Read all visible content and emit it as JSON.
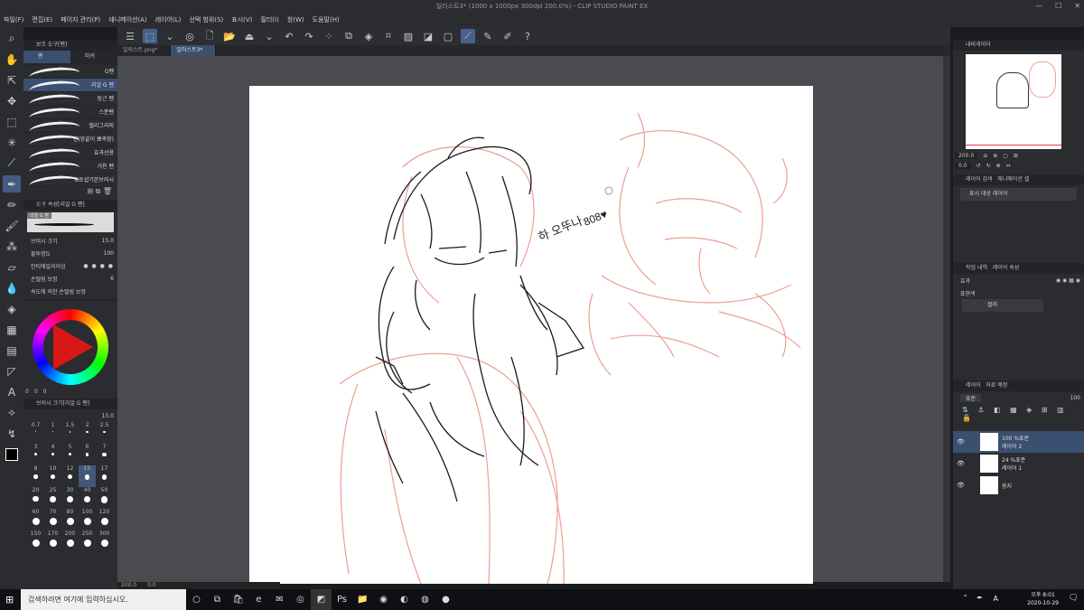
{
  "window": {
    "title": "일러스트3* (1000 x 1000px 300dpi 200.0%)  -  CLIP STUDIO PAINT EX",
    "controls": [
      "—",
      "☐",
      "✕"
    ]
  },
  "menu": [
    "파일(F)",
    "편집(E)",
    "페이지 관리(P)",
    "애니메이션(A)",
    "레이어(L)",
    "선택 범위(S)",
    "표시(V)",
    "필터(I)",
    "창(W)",
    "도움말(H)"
  ],
  "doc_tabs": [
    {
      "label": "일러스트.png*",
      "active": false
    },
    {
      "label": "일러스트3*",
      "active": true
    }
  ],
  "sub_tool_panel": {
    "title": "보조 도구[펜]",
    "tabs": [
      "펜",
      "마커"
    ],
    "brushes": [
      "G펜",
      "리얼 G 펜",
      "둥근 펜",
      "스푼펜",
      "캘리그라피",
      "펜(망끝이 뾰족함)",
      "효과선용",
      "거친 펜",
      "포토샵기본브러시"
    ],
    "selected_brush_index": 1
  },
  "tool_property": {
    "title": "도구 속성[리얼 G 펜]",
    "preset": "리얼 G 펜",
    "brush_size_label": "브러시 크기",
    "brush_size": "15.0",
    "opacity_label": "불투명도",
    "opacity": "100",
    "anti_alias_label": "안티에일리어싱",
    "stabilization_label": "손떨림 보정",
    "stabilization": "6",
    "pressure_label": "속도에 의한 손떨림 보정"
  },
  "color_panel": {
    "values": [
      "0",
      "0",
      "0"
    ],
    "main_color": "#000000",
    "sub_color": "#ffffff"
  },
  "brush_size_panel": {
    "title": "브러시 크기[리얼 G 펜]",
    "current": "15.0",
    "sizes": [
      "0.7",
      "1",
      "1.5",
      "2",
      "2.5",
      "3",
      "4",
      "5",
      "6",
      "7",
      "8",
      "10",
      "12",
      "15",
      "17",
      "20",
      "25",
      "30",
      "40",
      "50",
      "60",
      "70",
      "80",
      "100",
      "120",
      "150",
      "170",
      "200",
      "250",
      "300"
    ],
    "selected": "15"
  },
  "navigator": {
    "title": "내비게이터",
    "zoom": "200.0",
    "angle": "0.0"
  },
  "layer_search": {
    "title": "레이어 검색",
    "tab2": "애니메이션 셀",
    "placeholder": "표시 대상 레이어"
  },
  "layer_property": {
    "tab1": "작업 내역",
    "tab2": "레이어 속성",
    "effect_label": "효과",
    "expression_label": "표현색",
    "expression_value": "컬러"
  },
  "layers_panel": {
    "tab1": "레이어",
    "tab2": "자료 예정",
    "blend": "표준",
    "opacity": "100",
    "layers": [
      {
        "mode": "100 %표준",
        "name": "레이어 2",
        "selected": true
      },
      {
        "mode": "24 %표준",
        "name": "레이어 1",
        "selected": false
      },
      {
        "mode": "",
        "name": "용지",
        "selected": false
      }
    ]
  },
  "status": {
    "zoom": "200.0",
    "angle": "0.0"
  },
  "taskbar": {
    "search_placeholder": "검색하려면 여기에 입력하십시오.",
    "time": "오후 8:01",
    "date": "2020-10-29",
    "lang": "A"
  },
  "canvas": {
    "handwriting_1": "하 오뚜나",
    "handwriting_2": "808♥"
  },
  "colors": {
    "accent": "#435a82",
    "sketch_red": "#ee9d93",
    "line_art": "#1a1a1a"
  }
}
